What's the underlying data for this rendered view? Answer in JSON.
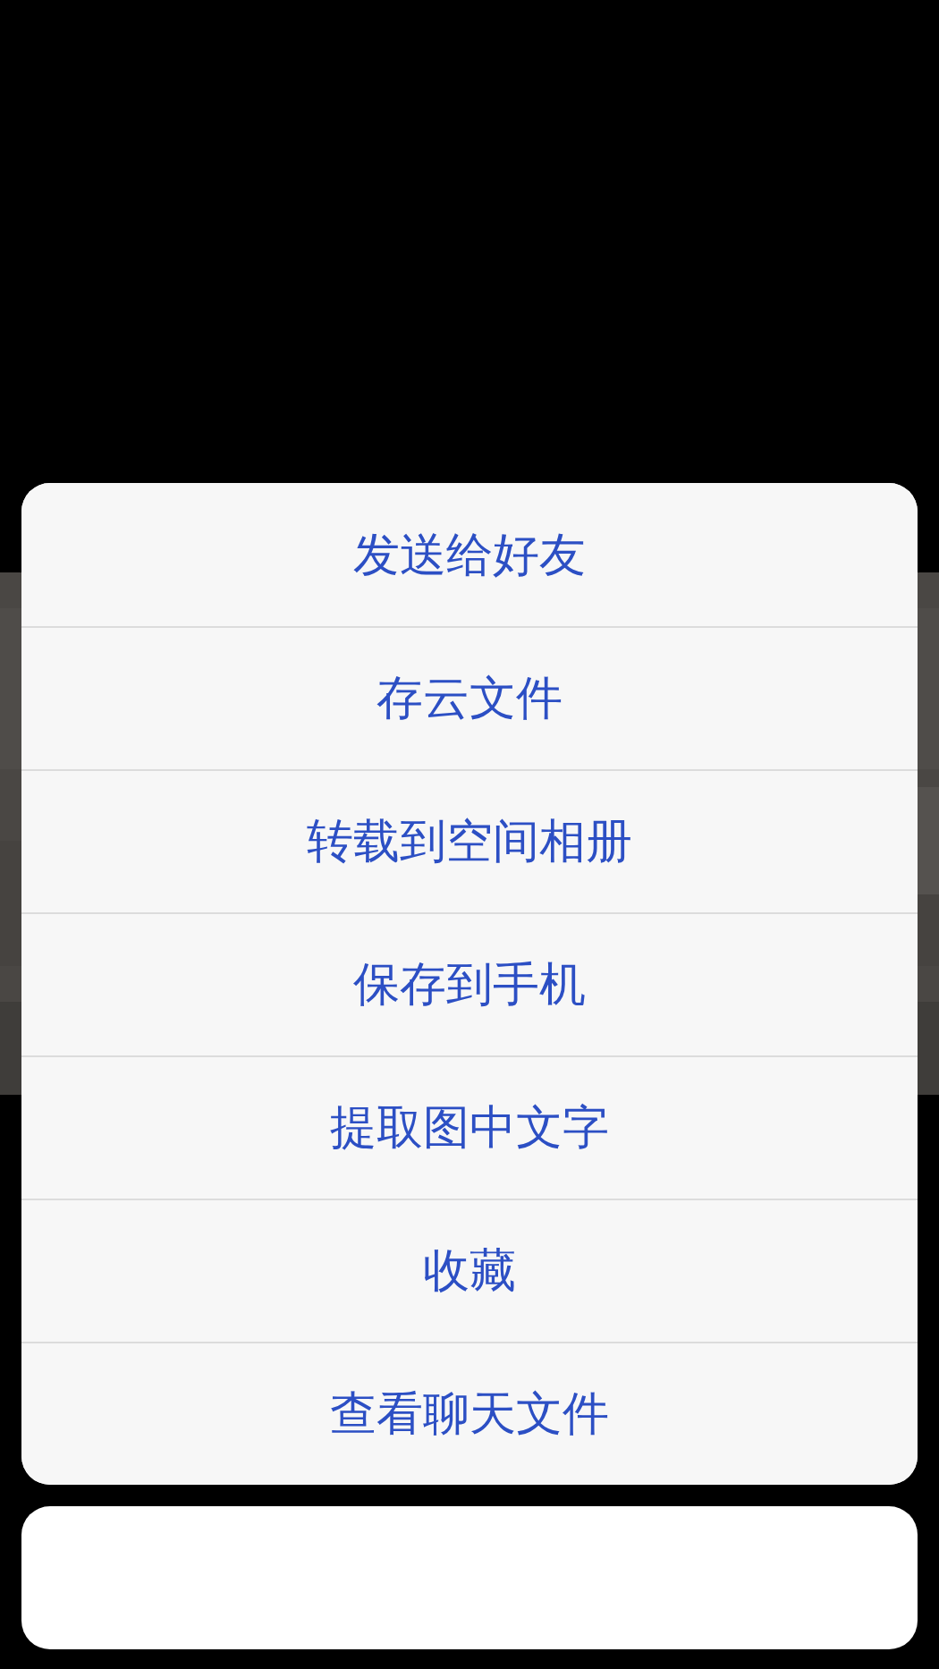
{
  "action_sheet": {
    "items": [
      {
        "label": "发送给好友"
      },
      {
        "label": "存云文件"
      },
      {
        "label": "转载到空间相册"
      },
      {
        "label": "保存到手机"
      },
      {
        "label": "提取图中文字"
      },
      {
        "label": "收藏"
      },
      {
        "label": "查看聊天文件"
      }
    ]
  }
}
